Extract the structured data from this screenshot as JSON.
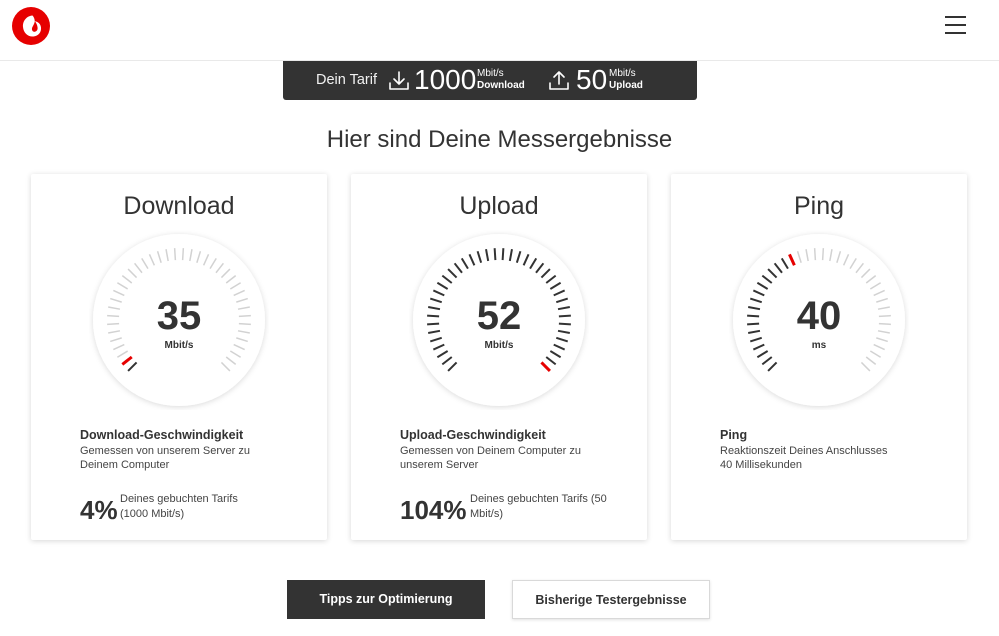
{
  "header": {
    "logo_icon": "vodafone-logo-icon",
    "menu_icon": "hamburger-menu-icon"
  },
  "tariff": {
    "label": "Dein Tarif",
    "download_value": "1000",
    "download_unit": "Mbit/s",
    "download_label": "Download",
    "upload_value": "50",
    "upload_unit": "Mbit/s",
    "upload_label": "Upload"
  },
  "page_title": "Hier sind Deine Messergebnisse",
  "cards": {
    "download": {
      "title": "Download",
      "value": "35",
      "unit": "Mbit/s",
      "gauge_fraction": 0.035,
      "desc_title": "Download-Geschwindigkeit",
      "desc_text": "Gemessen von unserem Server zu Deinem Computer",
      "percent": "4%",
      "percent_text": "Deines gebuchten Tarifs (1000 Mbit/s)"
    },
    "upload": {
      "title": "Upload",
      "value": "52",
      "unit": "Mbit/s",
      "gauge_fraction": 1.0,
      "desc_title": "Upload-Geschwindigkeit",
      "desc_text": "Gemessen von Deinem Computer zu unserem Server",
      "percent": "104%",
      "percent_text": "Deines gebuchten Tarifs (50 Mbit/s)"
    },
    "ping": {
      "title": "Ping",
      "value": "40",
      "unit": "ms",
      "gauge_fraction": 0.4,
      "desc_title": "Ping",
      "desc_text": "Reaktionszeit Deines Anschlusses 40 Millisekunden"
    }
  },
  "buttons": {
    "tips": "Tipps zur Optimierung",
    "history": "Bisherige Testergebnisse"
  },
  "colors": {
    "brand_red": "#e60000",
    "dark": "#333333",
    "tick_inactive": "#d2d2d2",
    "tick_active": "#333333"
  }
}
